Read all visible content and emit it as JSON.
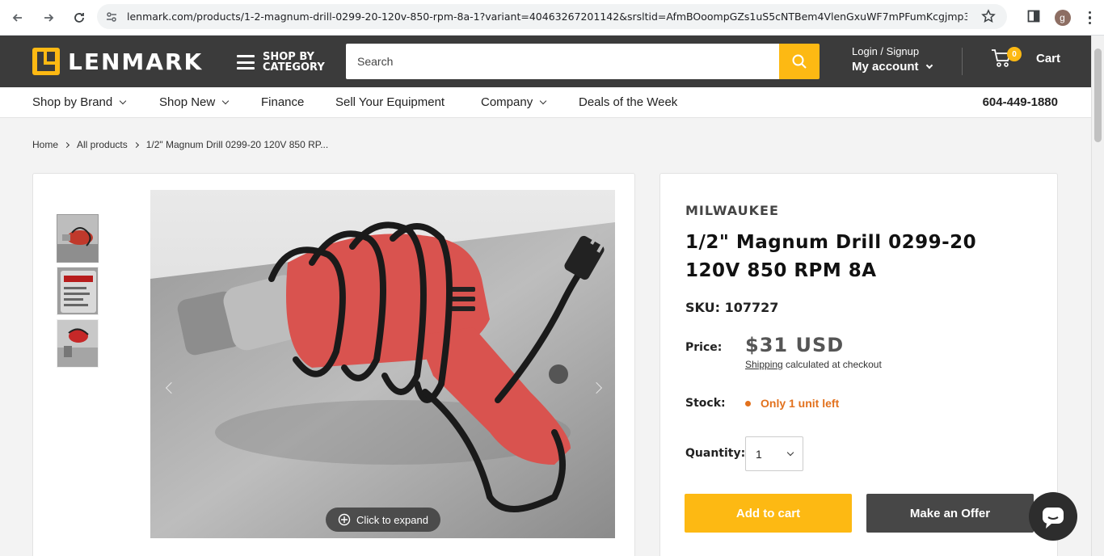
{
  "browser": {
    "url": "lenmark.com/products/1-2-magnum-drill-0299-20-120v-850-rpm-8a-1?variant=40463267201142&srsltid=AfmBOoompGZs1uS5cNTBem4VlenGxuWF7mPFumKcgjmp3...",
    "profile_initial": "g"
  },
  "header": {
    "logo_text": "LENMARK",
    "shop_by_category": "SHOP BY CATEGORY",
    "search_placeholder": "Search",
    "login_label": "Login / Signup",
    "account_label": "My account",
    "cart_count": "0",
    "cart_label": "Cart"
  },
  "nav": {
    "items": [
      {
        "label": "Shop by Brand",
        "dropdown": true
      },
      {
        "label": "Shop New",
        "dropdown": true
      },
      {
        "label": "Finance",
        "dropdown": false
      },
      {
        "label": "Sell Your Equipment",
        "dropdown": false
      },
      {
        "label": "Company",
        "dropdown": true
      },
      {
        "label": "Deals of the Week",
        "dropdown": false
      }
    ],
    "phone": "604-449-1880"
  },
  "breadcrumb": {
    "home": "Home",
    "all_products": "All products",
    "current": "1/2\" Magnum Drill 0299-20 120V 850 RP..."
  },
  "gallery": {
    "expand_label": "Click to expand",
    "thumbnail_count": 3
  },
  "product": {
    "brand": "MILWAUKEE",
    "title": "1/2\" Magnum Drill 0299-20 120V 850 RPM 8A",
    "sku": "SKU: 107727",
    "price_label": "Price:",
    "price": "$31 USD",
    "shipping_link": "Shipping",
    "shipping_rest": " calculated at checkout",
    "stock_label": "Stock:",
    "stock_value": "Only 1 unit left",
    "quantity_label": "Quantity:",
    "quantity_value": "1",
    "add_to_cart": "Add to cart",
    "make_offer": "Make an Offer"
  },
  "colors": {
    "brand_yellow": "#fdb913",
    "header_dark": "#3b3b3b",
    "stock_orange": "#e2711d"
  }
}
